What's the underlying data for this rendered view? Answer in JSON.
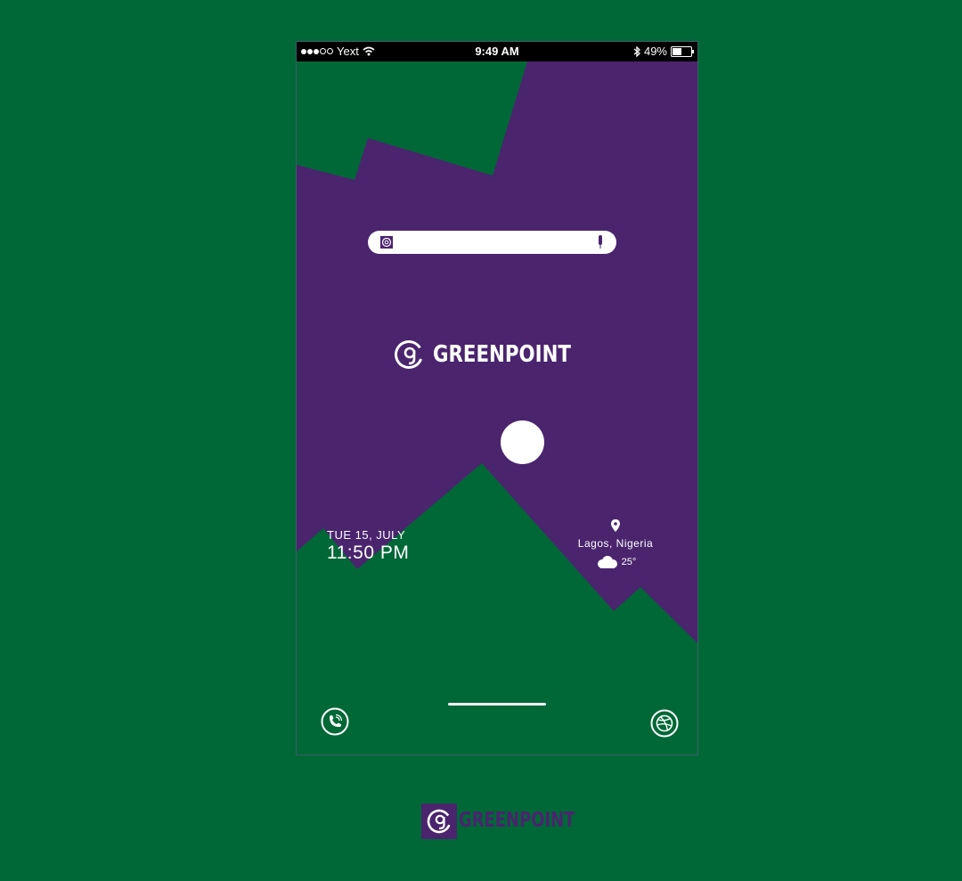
{
  "status_bar": {
    "carrier": "Yext",
    "time": "9:49 AM",
    "battery": "49%",
    "battery_level": 0.49,
    "signal_bars_filled": 3,
    "signal_bars_total": 5
  },
  "search": {
    "placeholder": ""
  },
  "brand": {
    "name": "GREENPOINT"
  },
  "clock": {
    "date": "TUE 15, JULY",
    "time": "11:50 PM"
  },
  "weather": {
    "location": "Lagos, Nigeria",
    "temperature": "25°",
    "condition_icon": "cloud-icon"
  },
  "dock": {
    "left_icon": "phone-call-icon",
    "right_icon": "dribbble-icon"
  },
  "footer": {
    "brand_name": "GREENPOINT"
  },
  "colors": {
    "background_green": "#006837",
    "purple": "#4b246e",
    "white": "#ffffff"
  }
}
